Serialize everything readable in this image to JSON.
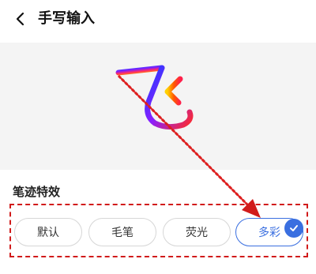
{
  "header": {
    "title": "手写输入",
    "back_icon": "chevron-left-icon"
  },
  "section": {
    "label": "笔迹特效"
  },
  "options": [
    {
      "label": "默认",
      "selected": false
    },
    {
      "label": "毛笔",
      "selected": false
    },
    {
      "label": "荧光",
      "selected": false
    },
    {
      "label": "多彩",
      "selected": true
    }
  ],
  "colors": {
    "accent": "#3a6fe0",
    "annotation_red": "#d11b1b",
    "canvas_bg": "#f4f4f4"
  }
}
